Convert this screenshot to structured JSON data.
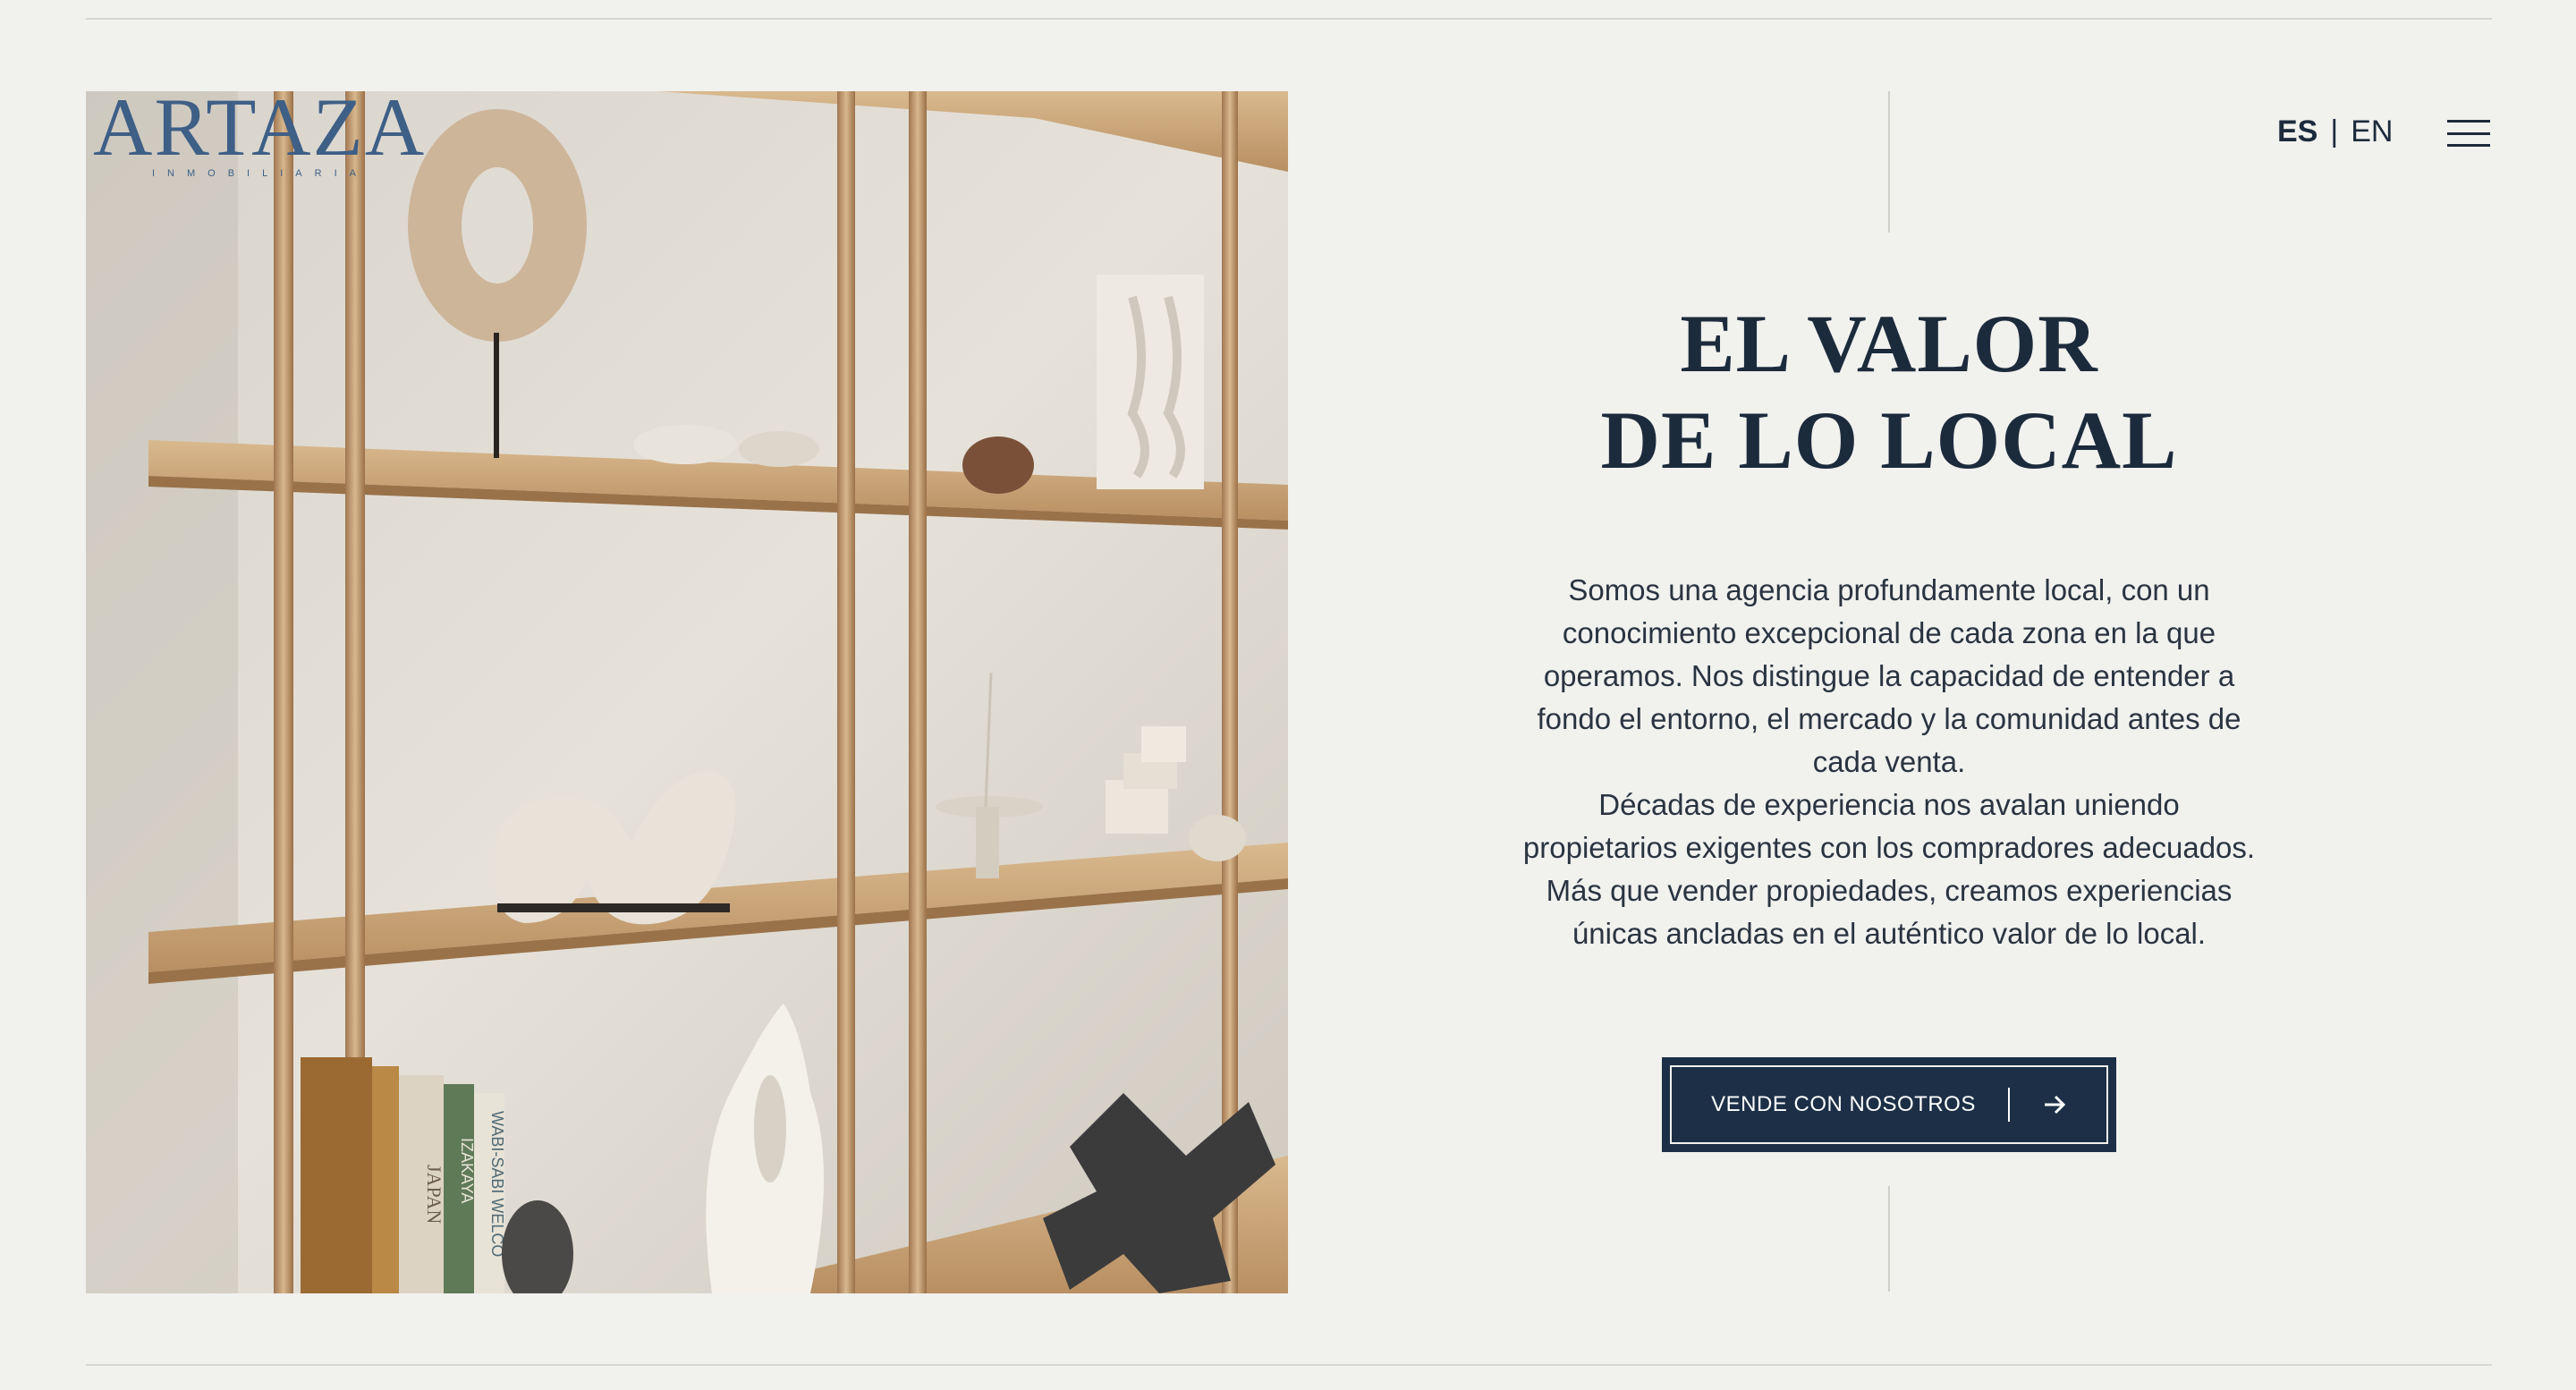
{
  "brand": {
    "name": "ARTAZA",
    "tagline": "INMOBILIARIA"
  },
  "header": {
    "lang_es": "ES",
    "lang_separator": "|",
    "lang_en": "EN",
    "menu_icon": "hamburger-menu-icon"
  },
  "hero": {
    "heading_line1": "EL VALOR",
    "heading_line2": "DE LO LOCAL",
    "paragraph1": "Somos una agencia profundamente local, con un conocimiento excepcional de cada zona en la que operamos. Nos distingue la capacidad de entender a fondo el entorno, el mercado y la comunidad antes de cada venta.",
    "paragraph2": "Décadas de experiencia nos avalan uniendo propietarios exigentes con los compradores adecuados. Más que vender propiedades, creamos experiencias únicas ancladas en el auténtico valor de lo local.",
    "cta_label": "VENDE CON NOSOTROS",
    "cta_icon": "arrow-right-icon"
  },
  "photo": {
    "books": [
      "JAPAN",
      "IZAKAYA",
      "WABI-SABI WELCO"
    ]
  },
  "colors": {
    "background": "#f1f1ee",
    "navy": "#1c2f47",
    "text": "#1c2b3c",
    "logo": "#3e5f86"
  }
}
